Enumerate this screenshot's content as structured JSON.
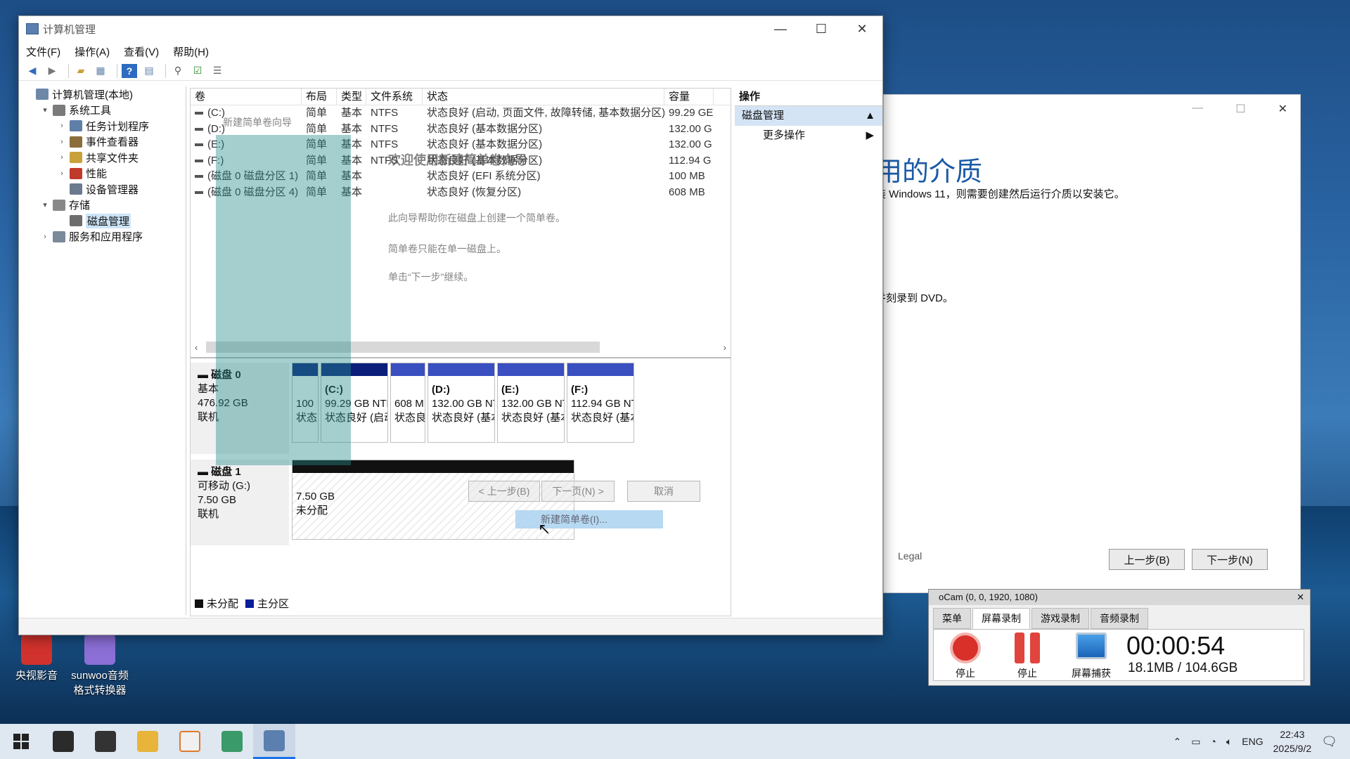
{
  "main_window": {
    "title": "计算机管理",
    "controls": [
      "—",
      "☐",
      "✕"
    ],
    "menu": [
      "文件(F)",
      "操作(A)",
      "查看(V)",
      "帮助(H)"
    ]
  },
  "tree": [
    {
      "label": "计算机管理(本地)",
      "level": 0,
      "twisty": "",
      "icon_color": "#6d87a8"
    },
    {
      "label": "系统工具",
      "level": 1,
      "twisty": "▾",
      "icon_color": "#7a7a7a"
    },
    {
      "label": "任务计划程序",
      "level": 2,
      "twisty": "›",
      "icon_color": "#5e7fa8"
    },
    {
      "label": "事件查看器",
      "level": 2,
      "twisty": "›",
      "icon_color": "#8a6d3b"
    },
    {
      "label": "共享文件夹",
      "level": 2,
      "twisty": "›",
      "icon_color": "#c9a13a"
    },
    {
      "label": "性能",
      "level": 2,
      "twisty": "›",
      "icon_color": "#c0392b"
    },
    {
      "label": "设备管理器",
      "level": 2,
      "twisty": "",
      "icon_color": "#6b7a8c"
    },
    {
      "label": "存储",
      "level": 1,
      "twisty": "▾",
      "icon_color": "#888888"
    },
    {
      "label": "磁盘管理",
      "level": 2,
      "twisty": "",
      "icon_color": "#6d6d6d",
      "selected": true
    },
    {
      "label": "服务和应用程序",
      "level": 1,
      "twisty": "›",
      "icon_color": "#7b8a9a"
    }
  ],
  "volume_table": {
    "headers": [
      "卷",
      "布局",
      "类型",
      "文件系统",
      "状态",
      "容量"
    ],
    "rows": [
      [
        "(C:)",
        "简单",
        "基本",
        "NTFS",
        "状态良好 (启动, 页面文件, 故障转储, 基本数据分区)",
        "99.29 GE"
      ],
      [
        "(D:)",
        "简单",
        "基本",
        "NTFS",
        "状态良好 (基本数据分区)",
        "132.00 G"
      ],
      [
        "(E:)",
        "简单",
        "基本",
        "NTFS",
        "状态良好 (基本数据分区)",
        "132.00 G"
      ],
      [
        "(F:)",
        "简单",
        "基本",
        "NTFS",
        "状态良好 (基本数据分区)",
        "112.94 G"
      ],
      [
        "(磁盘 0 磁盘分区 1)",
        "简单",
        "基本",
        "",
        "状态良好 (EFI 系统分区)",
        "100 MB"
      ],
      [
        "(磁盘 0 磁盘分区 4)",
        "简单",
        "基本",
        "",
        "状态良好 (恢复分区)",
        "608 MB"
      ]
    ]
  },
  "disk0": {
    "name": "磁盘 0",
    "type": "基本",
    "size": "476.92 GB",
    "state": "联机",
    "partitions": [
      {
        "line1": "100",
        "line2": "状态",
        "line0": "",
        "dark": true
      },
      {
        "line0": "(C:)",
        "line1": "99.29 GB NTF",
        "line2": "状态良好 (启动",
        "dark": true
      },
      {
        "line0": "",
        "line1": "608 M",
        "line2": "状态良",
        "dark": false
      },
      {
        "line0": "(D:)",
        "line1": "132.00 GB NTI",
        "line2": "状态良好 (基本",
        "dark": false
      },
      {
        "line0": "(E:)",
        "line1": "132.00 GB NTI",
        "line2": "状态良好 (基本",
        "dark": false
      },
      {
        "line0": "(F:)",
        "line1": "112.94 GB NTF",
        "line2": "状态良好 (基本",
        "dark": false
      }
    ]
  },
  "disk1": {
    "name": "磁盘 1",
    "type": "可移动 (G:)",
    "size": "7.50 GB",
    "state": "联机",
    "part_size": "7.50 GB",
    "part_status": "未分配"
  },
  "context_item": "新建简单卷(I)...",
  "legend": {
    "unallocated": "未分配",
    "primary": "主分区"
  },
  "actions": {
    "header": "操作",
    "section": "磁盘管理",
    "more": "更多操作"
  },
  "wizard_ghost": {
    "title": "新建简单卷向导",
    "heading": "欢迎使用新建简单卷向导",
    "line1": "此向导帮助你在磁盘上创建一个简单卷。",
    "line2": "简单卷只能在单一磁盘上。",
    "line3": "单击“下一步”继续。",
    "back": "< 上一步(B)",
    "next": "下一页(N) >",
    "cancel": "取消"
  },
  "setup_window": {
    "heading": "用的介质",
    "line1": "装 Windows 11，则需要创建然后运行介质以安装它。",
    "line2": "并刻录到 DVD。",
    "legal": "Legal",
    "back": "上一步(B)",
    "next": "下一步(N)"
  },
  "ocam": {
    "title": "oCam (0, 0, 1920, 1080)",
    "tabs": [
      "菜单",
      "屏幕录制",
      "游戏录制",
      "音频录制"
    ],
    "stop_label": "停止",
    "pause_label": "停止",
    "capture_label": "屏幕捕获",
    "time": "00:00:54",
    "size": "18.1MB / 104.6GB"
  },
  "desktop_icons": [
    {
      "label": "央视影音"
    },
    {
      "label": "sunwoo音频格式转换器"
    }
  ],
  "taskbar": {
    "lang": "ENG",
    "time": "22:43",
    "date": "2025/9/2"
  }
}
